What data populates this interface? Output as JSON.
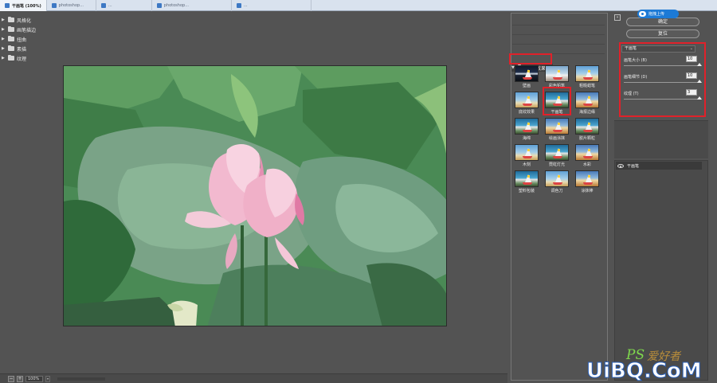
{
  "window": {
    "tabs": [
      {
        "label": "干画笔 (100%)",
        "active": true
      },
      {
        "label": "photoshop...",
        "active": false
      },
      {
        "label": "...",
        "active": false
      },
      {
        "label": "photoshop...",
        "active": false
      },
      {
        "label": "...",
        "active": false
      }
    ]
  },
  "status": {
    "zoom": "100%"
  },
  "gallery": {
    "categories": [
      {
        "label": "风格化",
        "open": false
      },
      {
        "label": "画笔描边",
        "open": false
      },
      {
        "label": "扭曲",
        "open": false
      },
      {
        "label": "素描",
        "open": false
      },
      {
        "label": "纹理",
        "open": false
      },
      {
        "label": "艺术效果",
        "open": true
      }
    ],
    "filters": [
      {
        "label": "壁画",
        "style": "dark"
      },
      {
        "label": "彩色铅笔",
        "style": "sketch"
      },
      {
        "label": "粗糙蜡笔",
        "style": "pastel"
      },
      {
        "label": "底纹效果",
        "style": "pastel"
      },
      {
        "label": "干画笔",
        "style": "teal",
        "selected": true
      },
      {
        "label": "海报边缘",
        "style": "warm"
      },
      {
        "label": "海绵",
        "style": "teal"
      },
      {
        "label": "绘画涂抹",
        "style": "warm"
      },
      {
        "label": "胶片颗粒",
        "style": "teal"
      },
      {
        "label": "木刻",
        "style": "pastel"
      },
      {
        "label": "霓虹灯光",
        "style": "teal"
      },
      {
        "label": "水彩",
        "style": "warm"
      },
      {
        "label": "塑料包装",
        "style": "teal"
      },
      {
        "label": "调色刀",
        "style": "pastel"
      },
      {
        "label": "涂抹棒",
        "style": "warm"
      }
    ]
  },
  "controls": {
    "collapse_icon": "»",
    "ok_label": "确定",
    "reset_label": "复位",
    "upload_badge": "拖拽上传",
    "filter_name": "干画笔",
    "params": [
      {
        "label": "画笔大小 (B)",
        "value": "10",
        "fraction": 1.0
      },
      {
        "label": "画笔细节 (D)",
        "value": "10",
        "fraction": 1.0
      },
      {
        "label": "纹理 (T)",
        "value": "3",
        "fraction": 1.0
      }
    ],
    "layer_name": "干画笔"
  },
  "watermark": {
    "ps": "PS",
    "cn": "爱好者",
    "site": "UiBQ.CoM"
  },
  "colors": {
    "highlight": "#e0212a",
    "badge": "#1c7ad6",
    "panel": "#535353"
  }
}
